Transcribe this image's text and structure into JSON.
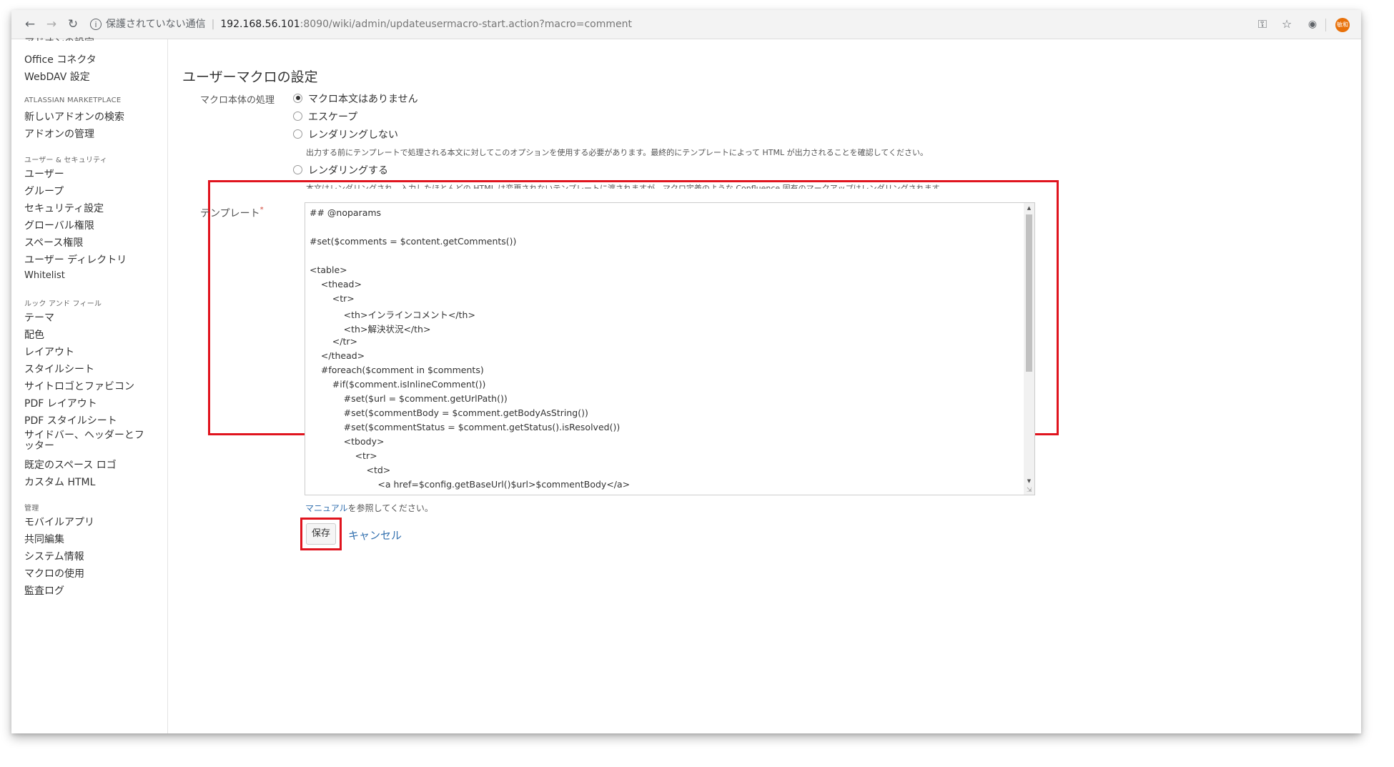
{
  "browser": {
    "security_text": "保護されていない通信",
    "url_host": "192.168.56.101",
    "url_path": ":8090/wiki/admin/updateusermacro-start.action?macro=comment",
    "profile_initials": "敏和"
  },
  "sidebar": {
    "cut_item": "アドオンの設定",
    "items_top": [
      "Office コネクタ",
      "WebDAV 設定"
    ],
    "marketplace_heading": "ATLASSIAN MARKETPLACE",
    "marketplace_items": [
      "新しいアドオンの検索",
      "アドオンの管理"
    ],
    "security_heading": "ユーザー & セキュリティ",
    "security_items": [
      "ユーザー",
      "グループ",
      "セキュリティ設定",
      "グローバル権限",
      "スペース権限",
      "ユーザー ディレクトリ",
      "Whitelist"
    ],
    "look_heading": "ルック アンド フィール",
    "look_items": [
      "テーマ",
      "配色",
      "レイアウト",
      "スタイルシート",
      "サイトロゴとファビコン",
      "PDF レイアウト",
      "PDF スタイルシート",
      "サイドバー、ヘッダーとフッター",
      "既定のスペース ロゴ",
      "カスタム HTML"
    ],
    "admin_heading": "管理",
    "admin_items": [
      "モバイルアプリ",
      "共同編集",
      "システム情報",
      "マクロの使用",
      "監査ログ"
    ]
  },
  "main": {
    "title": "ユーザーマクロの設定",
    "body_processing_label": "マクロ本体の処理",
    "options": [
      {
        "label": "マクロ本文はありません",
        "checked": true
      },
      {
        "label": "エスケープ",
        "checked": false
      },
      {
        "label": "レンダリングしない",
        "checked": false
      },
      {
        "label": "レンダリングする",
        "checked": false
      }
    ],
    "desc_no_render": "出力する前にテンプレートで処理される本文に対してこのオプションを使用する必要があります。最終的にテンプレートによって HTML が出力されることを確認してください。",
    "desc_render": "本文はレンダリングされ、入力したほとんどの HTML は変更されないテンプレートに渡されますが、マクロ定義のような Confluence 固有のマークアップはレンダリングされます。",
    "template_label": "テンプレート",
    "required_mark": "*",
    "template_lines": [
      "## @noparams",
      "",
      "#set($comments = $content.getComments())",
      "",
      "<table>",
      "    <thead>",
      "        <tr>",
      "            <th>インラインコメント</th>",
      "            <th>解決状況</th>",
      "        </tr>",
      "    </thead>",
      "    #foreach($comment in $comments)",
      "        #if($comment.isInlineComment())",
      "            #set($url = $comment.getUrlPath())",
      "            #set($commentBody = $comment.getBodyAsString())",
      "            #set($commentStatus = $comment.getStatus().isResolved())",
      "            <tbody>",
      "                <tr>",
      "                    <td>",
      "                        <a href=$config.getBaseUrl()$url>$commentBody</a>"
    ],
    "help_link": "マニュアル",
    "help_suffix": "を参照してください。",
    "save_label": "保存",
    "cancel_label": "キャンセル"
  },
  "colors": {
    "highlight": "#e0141e",
    "link": "#3572b0",
    "profile": "#e8710a"
  }
}
